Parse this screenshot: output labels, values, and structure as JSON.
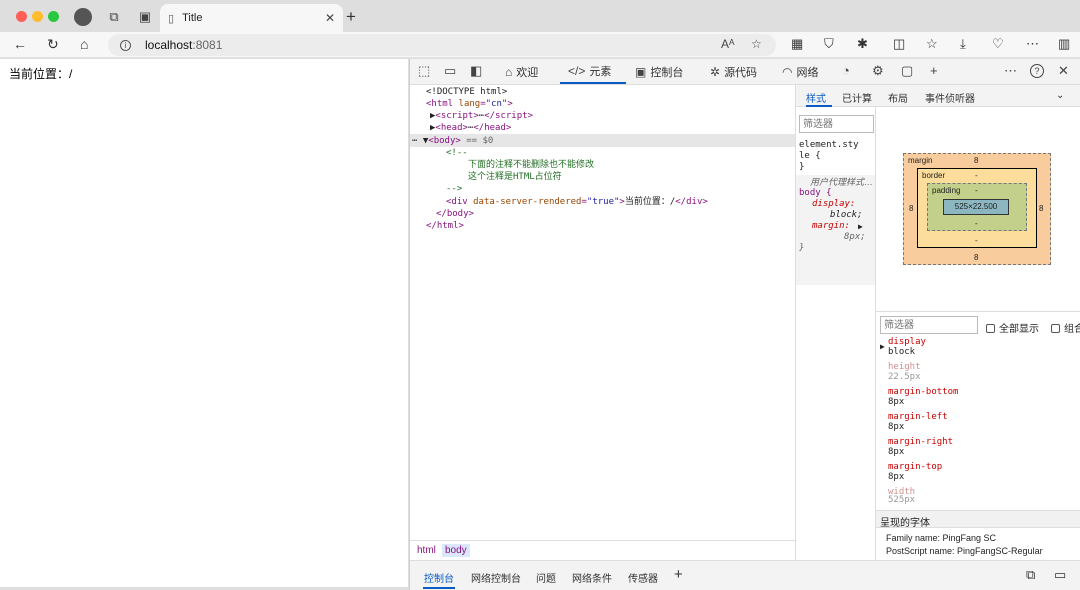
{
  "browser": {
    "tab_title": "Title",
    "address_host": "localhost",
    "address_port": ":8081",
    "colors": {
      "close": "#ff5f57",
      "minimize": "#febc2e",
      "maximize": "#28c840",
      "accent": "#0a5bc4"
    }
  },
  "page": {
    "content": "当前位置：/"
  },
  "devtools": {
    "tabs": [
      "欢迎",
      "元素",
      "控制台",
      "源代码",
      "网络"
    ],
    "tree": {
      "doctype": "<!DOCTYPE html>",
      "html_tag": "html",
      "lang_attr": "lang",
      "lang_val": "\"cn\"",
      "script_tag": "script",
      "head_tag": "head",
      "body_tag": "body",
      "selected_marker": "== $0",
      "comment_open": "<!--",
      "comment_line1": "下面的注释不能删除也不能修改",
      "comment_line2": "这个注释是HTML占位符",
      "comment_close": "-->",
      "div_tag": "div",
      "div_attr": "data-server-rendered",
      "div_val": "\"true\"",
      "div_text": "当前位置：/",
      "close_body": "</body>",
      "close_html": "</html>"
    },
    "breadcrumbs": [
      "html",
      "body"
    ],
    "drawer_tabs": [
      "控制台",
      "网络控制台",
      "问题",
      "网络条件",
      "传感器"
    ],
    "styles": {
      "tabs": [
        "样式",
        "已计算",
        "布局",
        "事件侦听器"
      ],
      "filter_placeholder": "筛选器",
      "rule1_selector_a": "element.sty",
      "rule1_selector_b": "le {",
      "rule1_close": "}",
      "ua_label": "用户代理样式…",
      "rule2_selector": "body {",
      "rule2_p1": "display:",
      "rule2_v1": "block;",
      "rule2_p2": "margin:",
      "rule2_v2": "8px;",
      "rule2_close": "}"
    },
    "box_model": {
      "margin_label": "margin",
      "border_label": "border",
      "padding_label": "padding",
      "margin": "8",
      "border": "-",
      "padding": "-",
      "content": "525×22.500"
    },
    "computed": {
      "filter_placeholder": "筛选器",
      "show_all": "全部显示",
      "group": "组合",
      "props": [
        {
          "name": "display",
          "value": "block"
        },
        {
          "name": "height",
          "value": "22.5px"
        },
        {
          "name": "margin-bottom",
          "value": "8px"
        },
        {
          "name": "margin-left",
          "value": "8px"
        },
        {
          "name": "margin-right",
          "value": "8px"
        },
        {
          "name": "margin-top",
          "value": "8px"
        },
        {
          "name": "width",
          "value": "525px"
        }
      ],
      "fonts_header": "呈现的字体",
      "family_line": "Family name: PingFang SC",
      "postscript_line": "PostScript name: PingFangSC-Regular"
    }
  }
}
